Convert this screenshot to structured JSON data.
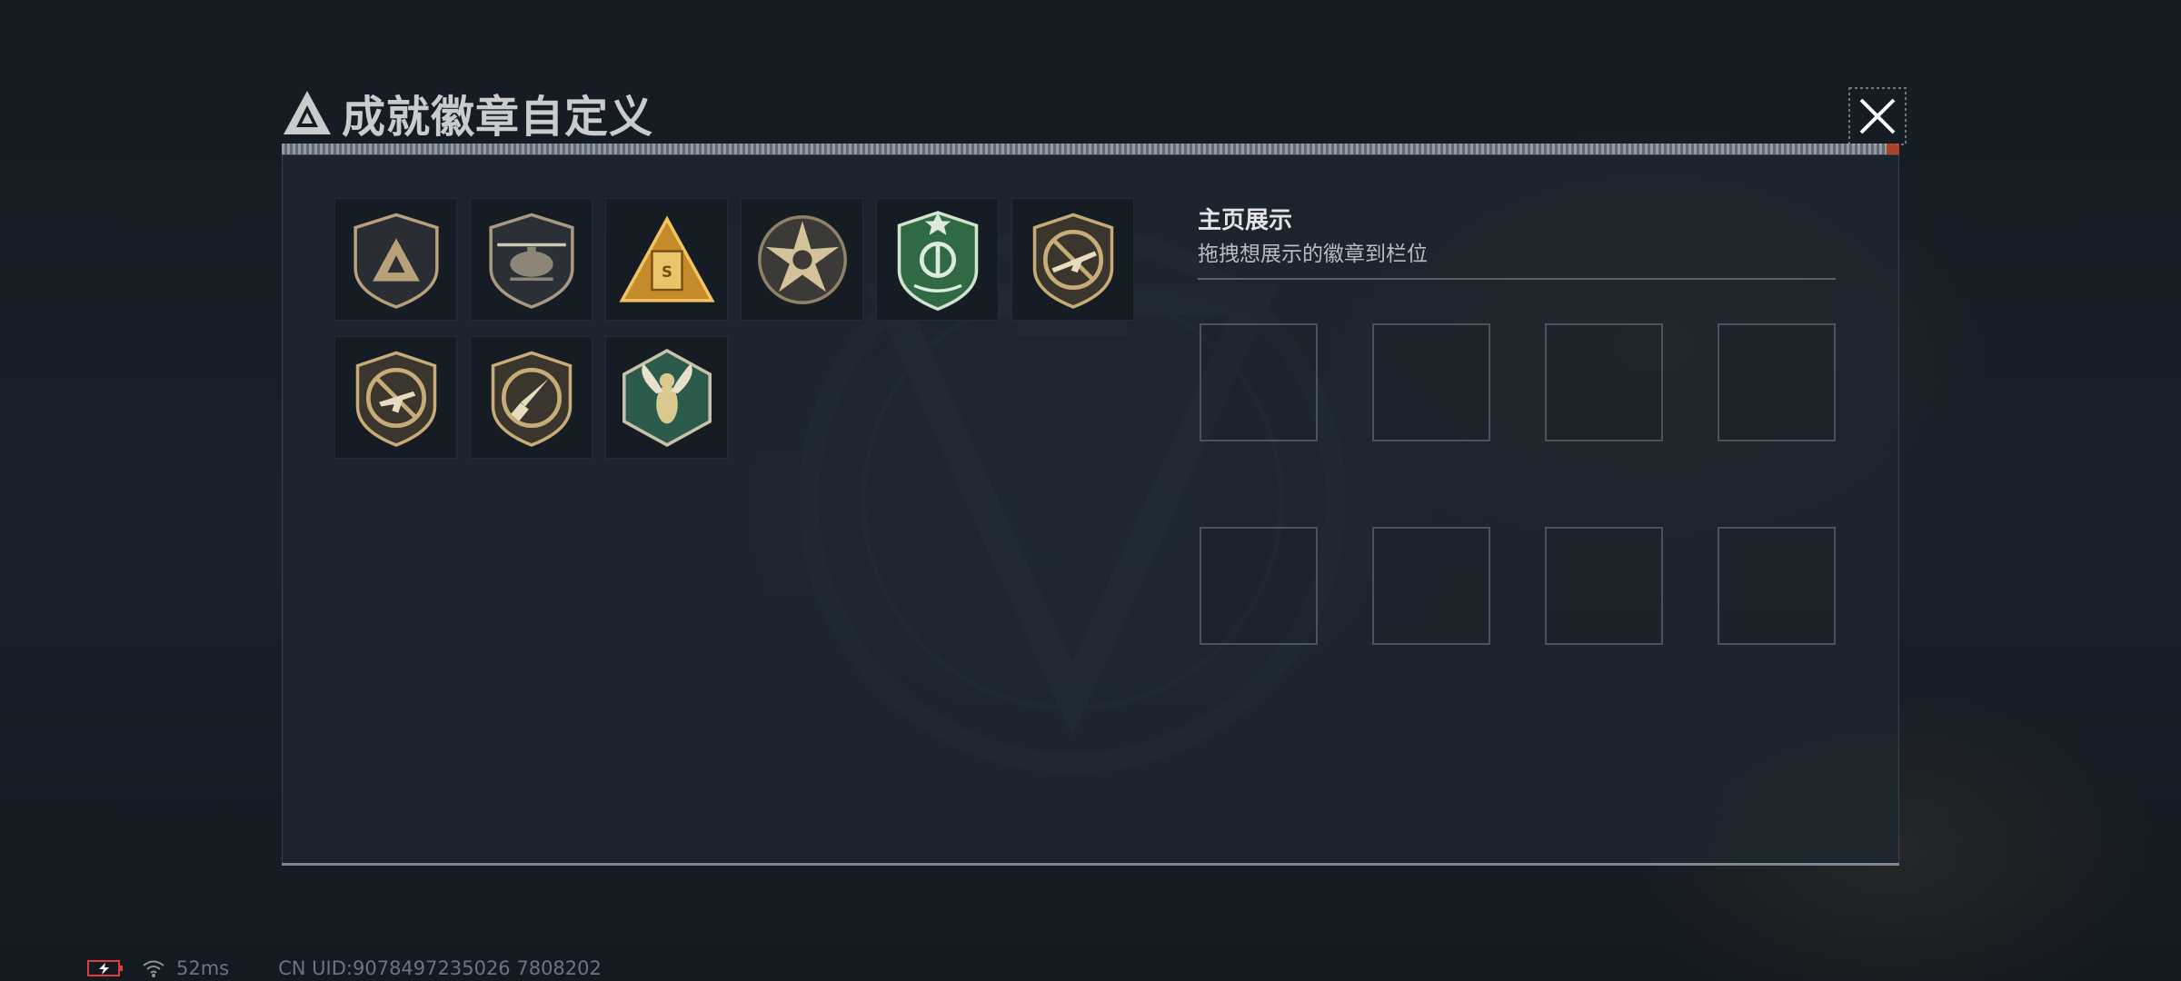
{
  "header": {
    "title": "成就徽章自定义",
    "close_icon": "close-icon"
  },
  "badges": [
    {
      "name": "triangle-logo-badge",
      "style": "dark-shield",
      "accent": "#b7a07a"
    },
    {
      "name": "helicopter-badge",
      "style": "dark-shield",
      "accent": "#a89a80"
    },
    {
      "name": "gold-triangle-badge",
      "style": "gold-triangle",
      "accent": "#d3a64d"
    },
    {
      "name": "star-skull-badge",
      "style": "round-star",
      "accent": "#c9b48a"
    },
    {
      "name": "green-shield-badge",
      "style": "green-shield",
      "accent": "#4e9a6a"
    },
    {
      "name": "rifle-badge",
      "style": "gold-shield-no-weapon",
      "accent": "#c8ac78"
    },
    {
      "name": "smg-badge",
      "style": "gold-shield-no-weapon",
      "accent": "#c8ac78"
    },
    {
      "name": "knife-badge",
      "style": "gold-shield-no-weapon",
      "accent": "#c8ac78"
    },
    {
      "name": "hornet-badge",
      "style": "green-hexagon",
      "accent": "#3d6a5a"
    }
  ],
  "showcase": {
    "title": "主页展示",
    "subtitle": "拖拽想展示的徽章到栏位",
    "slot_count": 8
  },
  "status": {
    "battery_icon": "battery-charging-icon",
    "wifi_icon": "wifi-icon",
    "ping": "52ms",
    "uid": "CN UID:9078497235026 7808202"
  },
  "colors": {
    "background": "#141a21",
    "panel": "#1e262f",
    "title_text": "#c9cbcd",
    "battery_low": "#e23b3b"
  }
}
